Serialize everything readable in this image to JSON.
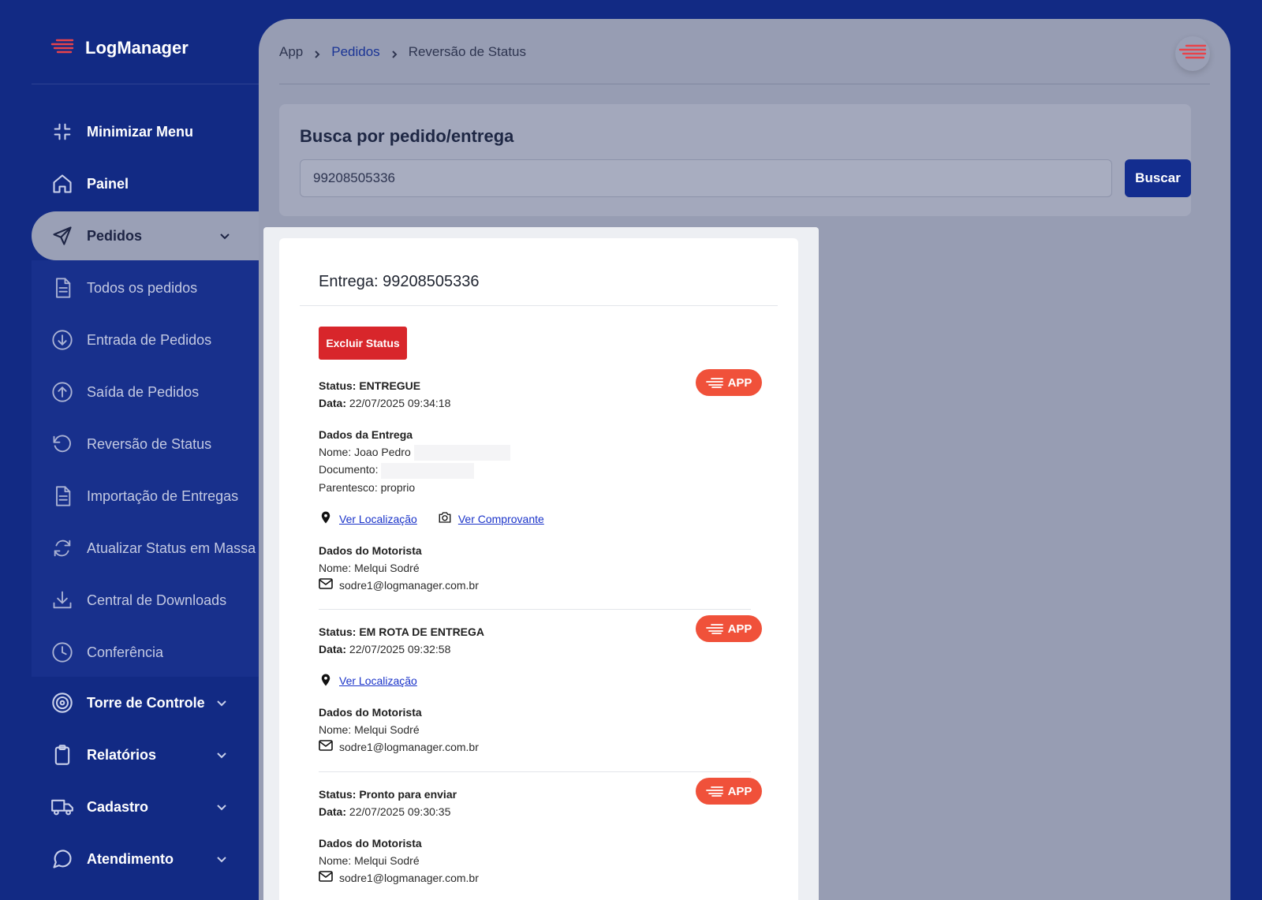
{
  "app": {
    "name": "LogManager",
    "accent": "#122a84",
    "danger": "#d8262b",
    "badge": "#f0513a"
  },
  "sidebar": {
    "minimize": "Minimizar Menu",
    "painel": "Painel",
    "pedidos": "Pedidos",
    "sub": [
      "Todos os pedidos",
      "Entrada de Pedidos",
      "Saída de Pedidos",
      "Reversão de Status",
      "Importação de Entregas",
      "Atualizar Status em Massa",
      "Central de Downloads",
      "Conferência"
    ],
    "torre": "Torre de Controle",
    "relatorios": "Relatórios",
    "cadastro": "Cadastro",
    "atendimento": "Atendimento"
  },
  "breadcrumb": {
    "root": "App",
    "section": "Pedidos",
    "page": "Reversão de Status"
  },
  "search": {
    "title": "Busca por pedido/entrega",
    "value": "99208505336",
    "button": "Buscar"
  },
  "detail": {
    "title": "Entrega: 99208505336",
    "delete_button": "Excluir Status",
    "statuses": [
      {
        "status_label": "Status:",
        "status": "ENTREGUE",
        "date_label": "Data:",
        "date": "22/07/2025 09:34:18",
        "badge": "APP",
        "delivery_title": "Dados da Entrega",
        "nome": "Nome: Joao Pedro",
        "documento": "Documento:",
        "parentesco": "Parentesco: proprio",
        "location_link": "Ver Localização",
        "receipt_link": "Ver Comprovante",
        "driver_title": "Dados do Motorista",
        "driver_name": "Nome: Melqui Sodré",
        "driver_email": "sodre1@logmanager.com.br"
      },
      {
        "status_label": "Status:",
        "status": "EM ROTA DE ENTREGA",
        "date_label": "Data:",
        "date": "22/07/2025 09:32:58",
        "badge": "APP",
        "location_link": "Ver Localização",
        "driver_title": "Dados do Motorista",
        "driver_name": "Nome: Melqui Sodré",
        "driver_email": "sodre1@logmanager.com.br"
      },
      {
        "status_label": "Status:",
        "status": "Pronto para enviar",
        "date_label": "Data:",
        "date": "22/07/2025 09:30:35",
        "badge": "APP",
        "driver_title": "Dados do Motorista",
        "driver_name": "Nome: Melqui Sodré",
        "driver_email": "sodre1@logmanager.com.br"
      }
    ]
  }
}
